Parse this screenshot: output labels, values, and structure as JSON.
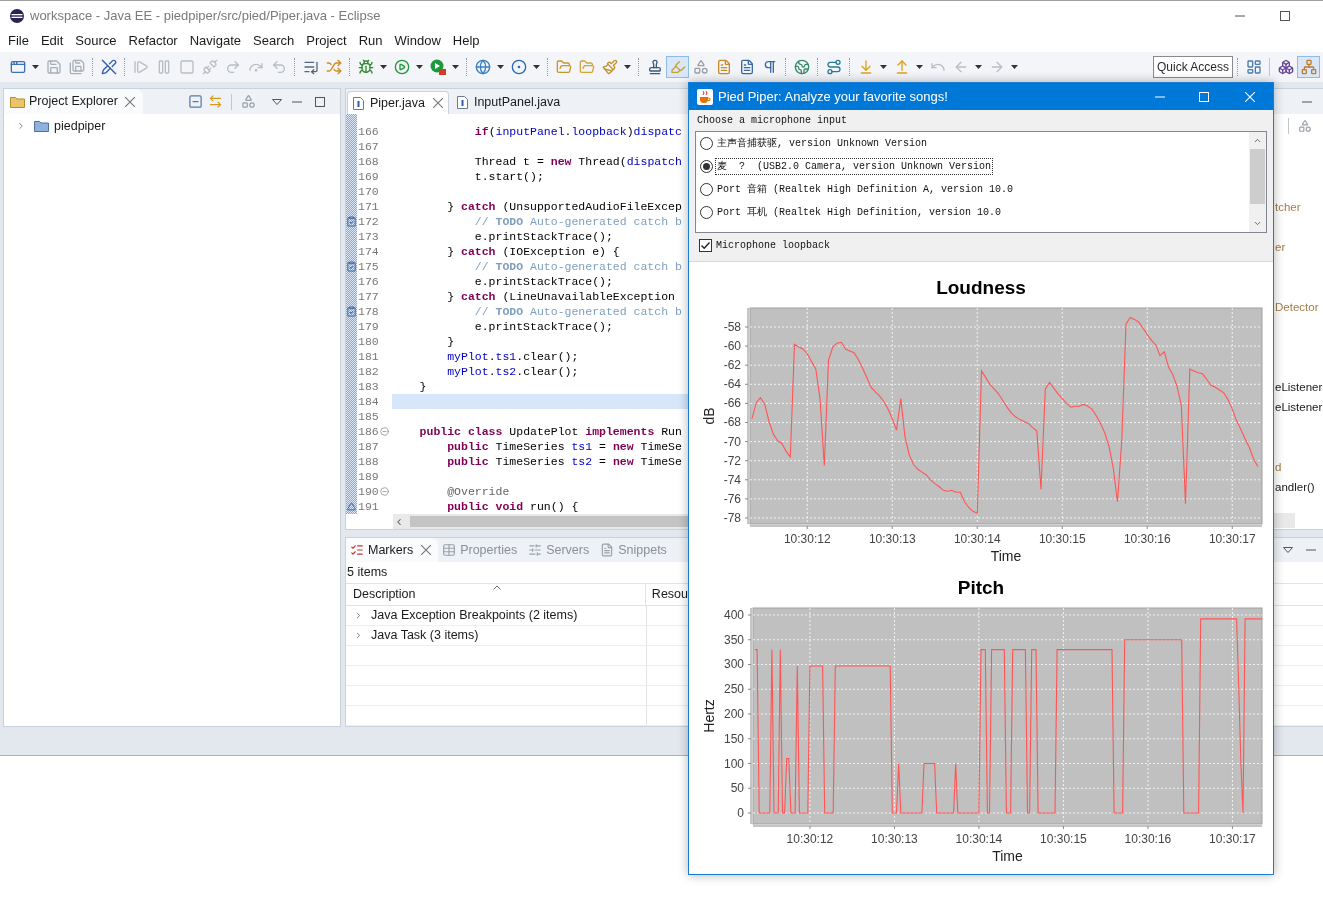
{
  "window": {
    "title": "workspace - Java EE - piedpiper/src/pied/Piper.java - Eclipse",
    "menu": [
      "File",
      "Edit",
      "Source",
      "Refactor",
      "Navigate",
      "Search",
      "Project",
      "Run",
      "Window",
      "Help"
    ],
    "toolbar": {
      "toggles": [
        {
          "on": true
        }
      ],
      "quick_access": {
        "placeholder": "Quick Access"
      },
      "perspectives": [
        {
          "selected": false
        },
        {
          "selected": true
        }
      ]
    },
    "project_explorer": {
      "tab": "Project Explorer",
      "tree": [
        {
          "label": "piedpiper",
          "expanded": false
        }
      ]
    },
    "editor": {
      "tabs": [
        {
          "label": "Piper.java",
          "selected": true
        },
        {
          "label": "InputPanel.java",
          "selected": false
        }
      ],
      "lines": [
        {
          "number": "166",
          "current": false,
          "fold": false,
          "tokens": [
            {
              "kind": "keyword",
              "text": "            if"
            },
            {
              "kind": "plain",
              "text": "("
            },
            {
              "kind": "field",
              "text": "inputPanel"
            },
            {
              "kind": "plain",
              "text": "."
            },
            {
              "kind": "field",
              "text": "loopback"
            },
            {
              "kind": "plain",
              "text": ")"
            },
            {
              "kind": "field",
              "text": "dispatc"
            }
          ]
        },
        {
          "number": "167",
          "current": false,
          "fold": false
        },
        {
          "number": "168",
          "current": false,
          "fold": false,
          "tokens": [
            {
              "kind": "plain",
              "text": "            Thread t = "
            },
            {
              "kind": "keyword",
              "text": "new"
            },
            {
              "kind": "plain",
              "text": " Thread("
            },
            {
              "kind": "field",
              "text": "dispatch"
            }
          ]
        },
        {
          "number": "169",
          "current": false,
          "fold": false,
          "tokens": [
            {
              "kind": "plain",
              "text": "            t.start();"
            }
          ]
        },
        {
          "number": "170",
          "current": false,
          "fold": false
        },
        {
          "number": "171",
          "current": false,
          "fold": false,
          "tokens": [
            {
              "kind": "plain",
              "text": "        } "
            },
            {
              "kind": "keyword",
              "text": "catch"
            },
            {
              "kind": "plain",
              "text": " (UnsupportedAudioFileExcep"
            }
          ]
        },
        {
          "number": "172",
          "current": false,
          "fold": false,
          "marker": {
            "kind": "task"
          },
          "tokens": [
            {
              "kind": "comment",
              "text": "            // "
            },
            {
              "kind": "todo",
              "text": "TODO"
            },
            {
              "kind": "comment",
              "text": " Auto-generated catch b"
            }
          ]
        },
        {
          "number": "173",
          "current": false,
          "fold": false,
          "tokens": [
            {
              "kind": "plain",
              "text": "            e.printStackTrace();"
            }
          ]
        },
        {
          "number": "174",
          "current": false,
          "fold": false,
          "tokens": [
            {
              "kind": "plain",
              "text": "        } "
            },
            {
              "kind": "keyword",
              "text": "catch"
            },
            {
              "kind": "plain",
              "text": " (IOException e) {"
            }
          ]
        },
        {
          "number": "175",
          "current": false,
          "fold": false,
          "marker": {
            "kind": "task"
          },
          "tokens": [
            {
              "kind": "comment",
              "text": "            // "
            },
            {
              "kind": "todo",
              "text": "TODO"
            },
            {
              "kind": "comment",
              "text": " Auto-generated catch b"
            }
          ]
        },
        {
          "number": "176",
          "current": false,
          "fold": false,
          "tokens": [
            {
              "kind": "plain",
              "text": "            e.printStackTrace();"
            }
          ]
        },
        {
          "number": "177",
          "current": false,
          "fold": false,
          "tokens": [
            {
              "kind": "plain",
              "text": "        } "
            },
            {
              "kind": "keyword",
              "text": "catch"
            },
            {
              "kind": "plain",
              "text": " (LineUnavailableException"
            }
          ]
        },
        {
          "number": "178",
          "current": false,
          "fold": false,
          "marker": {
            "kind": "task"
          },
          "tokens": [
            {
              "kind": "comment",
              "text": "            // "
            },
            {
              "kind": "todo",
              "text": "TODO"
            },
            {
              "kind": "comment",
              "text": " Auto-generated catch b"
            }
          ]
        },
        {
          "number": "179",
          "current": false,
          "fold": false,
          "tokens": [
            {
              "kind": "plain",
              "text": "            e.printStackTrace();"
            }
          ]
        },
        {
          "number": "180",
          "current": false,
          "fold": false,
          "tokens": [
            {
              "kind": "plain",
              "text": "        }"
            }
          ]
        },
        {
          "number": "181",
          "current": false,
          "fold": false,
          "tokens": [
            {
              "kind": "field",
              "text": "        myPlot"
            },
            {
              "kind": "plain",
              "text": "."
            },
            {
              "kind": "field",
              "text": "ts1"
            },
            {
              "kind": "plain",
              "text": ".clear();"
            }
          ]
        },
        {
          "number": "182",
          "current": false,
          "fold": false,
          "tokens": [
            {
              "kind": "field",
              "text": "        myPlot"
            },
            {
              "kind": "plain",
              "text": "."
            },
            {
              "kind": "field",
              "text": "ts2"
            },
            {
              "kind": "plain",
              "text": ".clear();"
            }
          ]
        },
        {
          "number": "183",
          "current": false,
          "fold": false,
          "tokens": [
            {
              "kind": "plain",
              "text": "    }"
            }
          ]
        },
        {
          "number": "184",
          "current": true,
          "fold": false
        },
        {
          "number": "185",
          "current": false,
          "fold": false
        },
        {
          "number": "186",
          "current": false,
          "fold": true,
          "tokens": [
            {
              "kind": "keyword",
              "text": "    public"
            },
            {
              "kind": "keyword",
              "text": " class"
            },
            {
              "kind": "plain",
              "text": " UpdatePlot "
            },
            {
              "kind": "keyword",
              "text": "implements"
            },
            {
              "kind": "plain",
              "text": " Run"
            }
          ]
        },
        {
          "number": "187",
          "current": false,
          "fold": false,
          "tokens": [
            {
              "kind": "keyword",
              "text": "        public"
            },
            {
              "kind": "plain",
              "text": " TimeSeries "
            },
            {
              "kind": "field",
              "text": "ts1"
            },
            {
              "kind": "plain",
              "text": " = "
            },
            {
              "kind": "keyword",
              "text": "new"
            },
            {
              "kind": "plain",
              "text": " TimeSe"
            }
          ]
        },
        {
          "number": "188",
          "current": false,
          "fold": false,
          "tokens": [
            {
              "kind": "keyword",
              "text": "        public"
            },
            {
              "kind": "plain",
              "text": " TimeSeries "
            },
            {
              "kind": "field",
              "text": "ts2"
            },
            {
              "kind": "plain",
              "text": " = "
            },
            {
              "kind": "keyword",
              "text": "new"
            },
            {
              "kind": "plain",
              "text": " TimeSe"
            }
          ]
        },
        {
          "number": "189",
          "current": false,
          "fold": false
        },
        {
          "number": "190",
          "current": false,
          "fold": true,
          "tokens": [
            {
              "kind": "annotation",
              "text": "        @Override"
            }
          ]
        },
        {
          "number": "191",
          "current": false,
          "fold": false,
          "marker": {
            "kind": "override"
          },
          "tokens": [
            {
              "kind": "keyword",
              "text": "        public"
            },
            {
              "kind": "keyword",
              "text": " void"
            },
            {
              "kind": "plain",
              "text": " run() {"
            }
          ]
        }
      ]
    },
    "outline": {
      "items": [
        {
          "text": "tcher",
          "kind": "type"
        },
        {
          "text": "er",
          "kind": "type"
        },
        {
          "text": "Detector",
          "kind": "type"
        },
        {
          "text": "eListener",
          "kind": "name"
        },
        {
          "text": "eListener",
          "kind": "name"
        },
        {
          "text": "d",
          "kind": "type"
        },
        {
          "text": "andler()",
          "kind": "name"
        }
      ]
    },
    "markers": {
      "tabs": [
        {
          "label": "Markers",
          "selected": true
        },
        {
          "label": "Properties",
          "selected": false
        },
        {
          "label": "Servers",
          "selected": false
        },
        {
          "label": "Snippets",
          "selected": false
        }
      ],
      "count": "5 items",
      "columns": [
        "Description",
        "Resou"
      ],
      "rows": [
        {
          "text": "Java Exception Breakpoints (2 items)",
          "expanded": false
        },
        {
          "text": "Java Task (3 items)",
          "expanded": false
        }
      ]
    }
  },
  "dialog": {
    "title": "Pied Piper: Analyze your favorite songs!",
    "input_label": "Choose a microphone input",
    "inputs": [
      {
        "label": "主声音捕获驱, version Unknown Version",
        "selected": false
      },
      {
        "label": "麦  ?  (USB2.0 Camera, version Unknown Version",
        "selected": true
      },
      {
        "label": "Port 音箱 (Realtek High Definition A, version 10.0",
        "selected": false
      },
      {
        "label": "Port 耳机 (Realtek High Definition, version 10.0",
        "selected": false
      }
    ],
    "loopback": {
      "label": "Microphone loopback",
      "checked": true
    },
    "loudness_chart": {
      "chart_data": {
        "type": "line",
        "title": "Loudness",
        "xlabel": "Time",
        "ylabel": "dB",
        "grid": true,
        "categories": [
          null,
          null,
          null,
          null,
          null,
          null,
          null,
          null,
          null,
          null,
          null,
          null,
          null,
          "10:30:12",
          null,
          null,
          null,
          null,
          null,
          null,
          null,
          null,
          null,
          null,
          null,
          null,
          null,
          null,
          null,
          null,
          null,
          null,
          null,
          "10:30:13",
          null,
          null,
          null,
          null,
          null,
          null,
          null,
          null,
          null,
          null,
          null,
          null,
          null,
          null,
          null,
          null,
          null,
          null,
          null,
          "10:30:14",
          null,
          null,
          null,
          null,
          null,
          null,
          null,
          null,
          null,
          null,
          null,
          null,
          null,
          null,
          null,
          null,
          null,
          null,
          null,
          "10:30:15",
          null,
          null,
          null,
          null,
          null,
          null,
          null,
          null,
          null,
          null,
          null,
          null,
          null,
          null,
          null,
          null,
          null,
          null,
          null,
          "10:30:16",
          null,
          null,
          null,
          null,
          null,
          null,
          null,
          null,
          null,
          null,
          null,
          null,
          null,
          null,
          null,
          null,
          null,
          null,
          null,
          "10:30:17",
          null,
          null,
          null,
          null,
          null,
          null,
          null
        ],
        "series": [
          {
            "color": "#ff5555",
            "values": [
              -67.6,
              -65.9,
              -65.4,
              -66.1,
              -67.9,
              -69.2,
              -69.9,
              -70.2,
              -71.0,
              -71.6,
              -59.8,
              -60.1,
              -60.3,
              -60.8,
              -61.6,
              -62.4,
              -65.5,
              -72.5,
              -61.5,
              -60.1,
              -59.7,
              -59.6,
              -60.3,
              -60.5,
              -60.7,
              -61.4,
              -62.3,
              -63.3,
              -64.3,
              -64.8,
              -65.2,
              -65.8,
              -66.6,
              -67.6,
              -68.8,
              -65.5,
              -69.5,
              -71.4,
              -72.4,
              -72.9,
              -73.2,
              -73.5,
              -74.0,
              -74.4,
              -74.7,
              -75.1,
              -75.2,
              -75.1,
              -75.3,
              -75.3,
              -76.3,
              -76.9,
              -77.3,
              -77.5,
              -62.6,
              -63.3,
              -64.0,
              -64.5,
              -65.0,
              -65.7,
              -66.4,
              -67.0,
              -67.4,
              -67.7,
              -67.9,
              -68.1,
              -68.5,
              -68.9,
              -75.0,
              -64.5,
              -63.8,
              -64.4,
              -65.0,
              -65.5,
              -66.0,
              -66.4,
              -66.3,
              -66.3,
              -66.1,
              -66.3,
              -66.6,
              -67.3,
              -68.1,
              -69.1,
              -70.5,
              -72.8,
              -76.3,
              -69.8,
              -57.7,
              -57.0,
              -57.2,
              -57.5,
              -58.1,
              -58.8,
              -59.4,
              -59.9,
              -61.0,
              -60.6,
              -62.2,
              -63.0,
              -64.2,
              -66.2,
              -76.5,
              -62.4,
              -62.6,
              -62.8,
              -62.9,
              -63.5,
              -64.1,
              -64.3,
              -64.6,
              -64.9,
              -65.6,
              -66.6,
              -67.8,
              -68.7,
              -69.7,
              -70.6,
              -71.8,
              -72.6,
              null
            ]
          }
        ],
        "ylim": [
          -78.63,
          -56.01
        ],
        "yticks": [
          -78,
          -76,
          -74,
          -72,
          -70,
          -68,
          -66,
          -64,
          -62,
          -60,
          -58
        ]
      }
    },
    "pitch_chart": {
      "chart_data": {
        "type": "line",
        "title": "Pitch",
        "xlabel": "Time",
        "ylabel": "Hertz",
        "grid": true,
        "categories": [
          null,
          null,
          null,
          null,
          null,
          null,
          null,
          null,
          null,
          null,
          null,
          null,
          null,
          null,
          null,
          null,
          null,
          null,
          null,
          null,
          null,
          null,
          null,
          null,
          null,
          null,
          "10:30:12",
          null,
          null,
          null,
          null,
          null,
          null,
          null,
          null,
          null,
          null,
          null,
          null,
          null,
          null,
          null,
          null,
          null,
          null,
          null,
          null,
          null,
          null,
          null,
          null,
          null,
          null,
          null,
          null,
          null,
          null,
          null,
          null,
          null,
          null,
          null,
          null,
          null,
          null,
          null,
          "10:30:13",
          null,
          null,
          null,
          null,
          null,
          null,
          null,
          null,
          null,
          null,
          null,
          null,
          null,
          null,
          null,
          null,
          null,
          null,
          null,
          null,
          null,
          null,
          null,
          null,
          null,
          null,
          null,
          null,
          null,
          null,
          null,
          null,
          null,
          null,
          null,
          null,
          null,
          null,
          null,
          "10:30:14",
          null,
          null,
          null,
          null,
          null,
          null,
          null,
          null,
          null,
          null,
          null,
          null,
          null,
          null,
          null,
          null,
          null,
          null,
          null,
          null,
          null,
          null,
          null,
          null,
          null,
          null,
          null,
          null,
          null,
          null,
          null,
          null,
          null,
          null,
          null,
          null,
          null,
          null,
          null,
          "10:30:15",
          null,
          null,
          null,
          null,
          null,
          null,
          null,
          null,
          null,
          null,
          null,
          null,
          null,
          null,
          null,
          null,
          null,
          null,
          null,
          null,
          null,
          null,
          null,
          null,
          null,
          null,
          null,
          null,
          null,
          null,
          null,
          null,
          null,
          null,
          null,
          null,
          null,
          null,
          null,
          "10:30:16",
          null,
          null,
          null,
          null,
          null,
          null,
          null,
          null,
          null,
          null,
          null,
          null,
          null,
          null,
          null,
          null,
          null,
          null,
          null,
          null,
          null,
          null,
          null,
          null,
          null,
          null,
          null,
          null,
          null,
          null,
          null,
          null,
          null,
          null,
          null,
          null,
          null,
          null,
          null,
          "10:30:17",
          null,
          null,
          null,
          null,
          null,
          null,
          null,
          null,
          null,
          null,
          null,
          null,
          null,
          null
        ],
        "series": [
          {
            "color": "#ff5555",
            "values": [
              330,
              330,
              0,
              0,
              0,
              0,
              0,
              0,
              330,
              0,
              0,
              0,
              330,
              0,
              0,
              110,
              110,
              0,
              0,
              0,
              297,
              0,
              0,
              0,
              0,
              0,
              297,
              297,
              297,
              297,
              297,
              297,
              297,
              0,
              0,
              0,
              0,
              0,
              297,
              297,
              297,
              297,
              297,
              297,
              297,
              297,
              297,
              297,
              297,
              297,
              297,
              297,
              297,
              297,
              297,
              297,
              297,
              297,
              297,
              297,
              297,
              297,
              297,
              297,
              297,
              0,
              0,
              0,
              100,
              0,
              0,
              0,
              0,
              0,
              0,
              0,
              0,
              0,
              0,
              0,
              100,
              100,
              100,
              100,
              100,
              100,
              0,
              0,
              0,
              0,
              0,
              0,
              0,
              0,
              0,
              100,
              0,
              0,
              0,
              0,
              0,
              0,
              0,
              0,
              0,
              0,
              0,
              330,
              330,
              330,
              0,
              0,
              330,
              330,
              330,
              330,
              330,
              330,
              330,
              0,
              0,
              0,
              330,
              330,
              330,
              330,
              330,
              330,
              330,
              0,
              0,
              330,
              330,
              330,
              0,
              0,
              0,
              0,
              0,
              0,
              0,
              0,
              0,
              330,
              330,
              330,
              330,
              330,
              330,
              330,
              330,
              330,
              330,
              330,
              330,
              330,
              330,
              330,
              330,
              330,
              330,
              330,
              330,
              330,
              330,
              330,
              330,
              330,
              330,
              330,
              0,
              0,
              0,
              0,
              0,
              350,
              350,
              350,
              350,
              350,
              350,
              350,
              350,
              350,
              350,
              350,
              350,
              350,
              350,
              350,
              350,
              350,
              350,
              350,
              350,
              350,
              350,
              350,
              350,
              350,
              350,
              350,
              350,
              0,
              0,
              0,
              0,
              0,
              0,
              0,
              0,
              392,
              392,
              392,
              392,
              392,
              392,
              392,
              392,
              392,
              392,
              392,
              392,
              392,
              392,
              392,
              392,
              392,
              392,
              250,
              100,
              0,
              392,
              392,
              392,
              392,
              392,
              392,
              392,
              392,
              392
            ]
          }
        ],
        "ylim": [
          -22.2,
          414.1
        ],
        "yticks": [
          0,
          50,
          100,
          150,
          200,
          250,
          300,
          350,
          400
        ]
      }
    }
  }
}
